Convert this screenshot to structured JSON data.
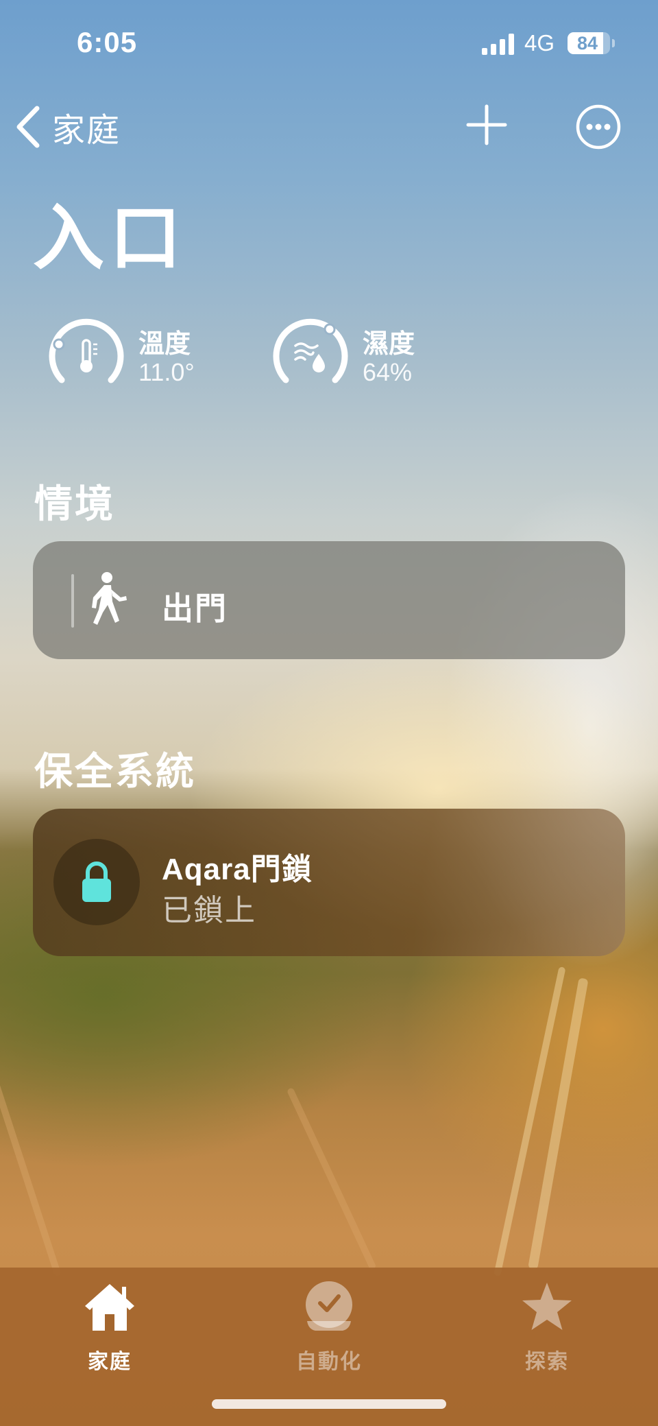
{
  "status_bar": {
    "time": "6:05",
    "network": "4G",
    "battery_percent": "84",
    "battery_level": 0.84
  },
  "nav": {
    "back_label": "家庭",
    "back_icon": "chevron-left-icon",
    "add_icon": "plus-icon",
    "more_icon": "ellipsis-circle-icon"
  },
  "page": {
    "title": "入口"
  },
  "sensors": [
    {
      "label": "溫度",
      "value": "11.0°",
      "icon": "thermometer-icon"
    },
    {
      "label": "濕度",
      "value": "64%",
      "icon": "humidity-icon"
    }
  ],
  "scenes": {
    "title": "情境",
    "items": [
      {
        "label": "出門",
        "icon": "walking-person-icon"
      }
    ]
  },
  "security": {
    "title": "保全系統",
    "items": [
      {
        "name": "Aqara門鎖",
        "status": "已鎖上",
        "icon": "lock-icon",
        "icon_color": "#5fe3dc"
      }
    ]
  },
  "tab_bar": {
    "tabs": [
      {
        "label": "家庭",
        "icon": "house-icon",
        "active": true
      },
      {
        "label": "自動化",
        "icon": "clock-check-icon",
        "active": false
      },
      {
        "label": "探索",
        "icon": "star-icon",
        "active": false
      }
    ]
  }
}
